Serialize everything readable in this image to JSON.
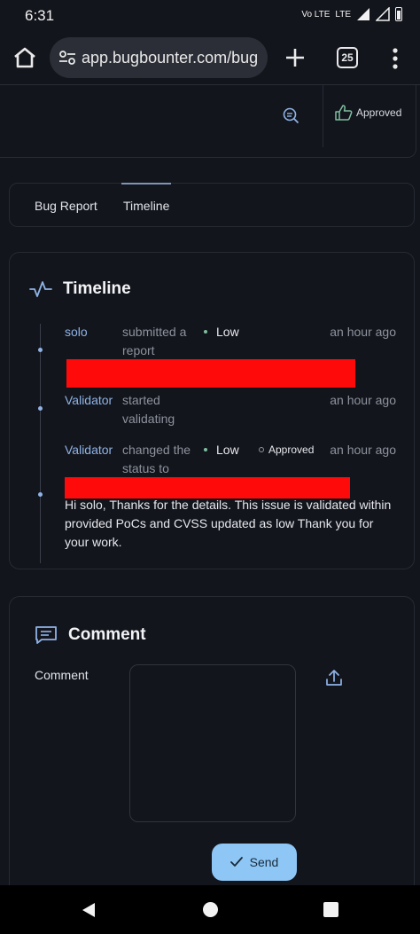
{
  "status_bar": {
    "time": "6:31",
    "network": "Vo LTE",
    "signal": "LTE"
  },
  "browser": {
    "url": "app.bugbounter.com/bug",
    "tab_count": "25"
  },
  "report_header": {
    "approved_label": "Approved"
  },
  "tabs": [
    {
      "label": "Bug Report"
    },
    {
      "label": "Timeline"
    }
  ],
  "timeline": {
    "title": "Timeline",
    "events": [
      {
        "actor": "solo",
        "action": "submitted a report",
        "severity": "Low",
        "time": "an hour ago"
      },
      {
        "actor": "Validator",
        "action": "started validating",
        "time": "an hour ago"
      },
      {
        "actor": "Validator",
        "action": "changed the status to",
        "severity": "Low",
        "status": "Approved",
        "time": "an hour ago"
      }
    ],
    "message": "Hi solo, Thanks for the details. This issue is validated within provided PoCs and CVSS updated as low Thank you for your work."
  },
  "comment": {
    "title": "Comment",
    "label": "Comment",
    "value": "",
    "send_label": "Send"
  },
  "colors": {
    "background": "#13151c",
    "accent": "#8fb3e6",
    "send_button": "#8ec7f5",
    "redaction": "#ff0a0a"
  }
}
